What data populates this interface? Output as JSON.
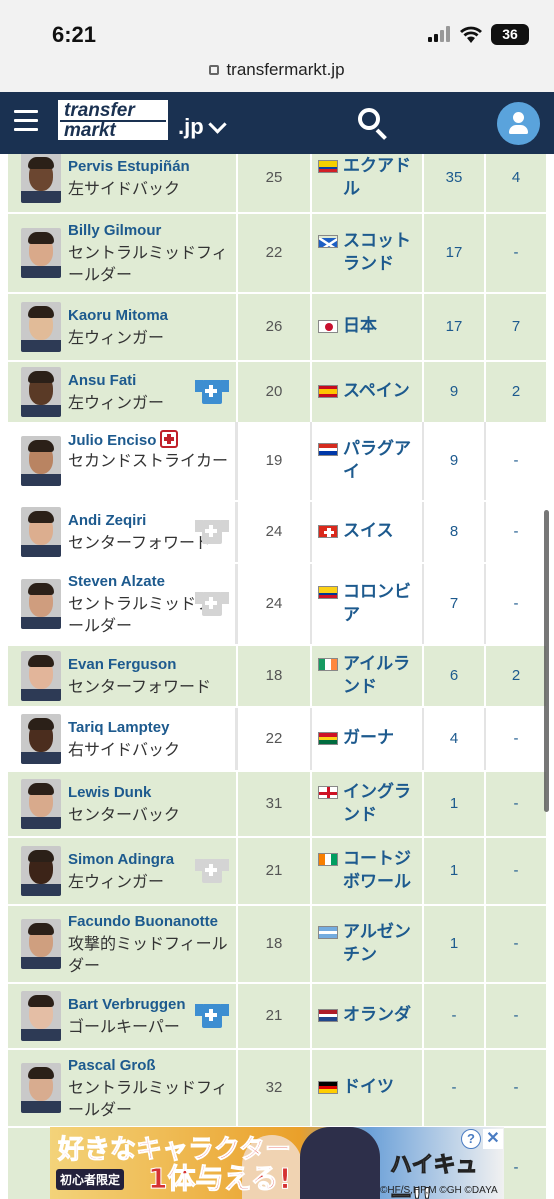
{
  "status": {
    "time": "6:21",
    "battery": "36"
  },
  "browser": {
    "url": "transfermarkt.jp"
  },
  "header": {
    "logo_line1": "transfer",
    "logo_line2": "markt",
    "domain": ".jp"
  },
  "players": [
    {
      "name": "Pervis Estupiñán",
      "position": "左サイドバック",
      "age": "25",
      "nationality": "エクアドル",
      "apps": "35",
      "goals": "4",
      "bg": "green",
      "flag": "ecuador",
      "shirt": "none",
      "injury": false,
      "skin": "#6b4630"
    },
    {
      "name": "Billy Gilmour",
      "position": "セントラルミッドフィールダー",
      "age": "22",
      "nationality": "スコットランド",
      "apps": "17",
      "goals": "-",
      "bg": "green",
      "flag": "scotland",
      "shirt": "none",
      "injury": false,
      "skin": "#d9a98a"
    },
    {
      "name": "Kaoru Mitoma",
      "position": "左ウィンガー",
      "age": "26",
      "nationality": "日本",
      "apps": "17",
      "goals": "7",
      "bg": "green",
      "flag": "japan",
      "shirt": "none",
      "injury": false,
      "skin": "#e1bb98"
    },
    {
      "name": "Ansu Fati",
      "position": "左ウィンガー",
      "age": "20",
      "nationality": "スペイン",
      "apps": "9",
      "goals": "2",
      "bg": "green",
      "flag": "spain",
      "shirt": "blue",
      "injury": false,
      "skin": "#5a3a26"
    },
    {
      "name": "Julio Enciso",
      "position": "セカンドストライカー",
      "age": "19",
      "nationality": "パラグアイ",
      "apps": "9",
      "goals": "-",
      "bg": "white",
      "flag": "paraguay",
      "shirt": "none",
      "injury": true,
      "skin": "#b98462"
    },
    {
      "name": "Andi Zeqiri",
      "position": "センターフォワード",
      "age": "24",
      "nationality": "スイス",
      "apps": "8",
      "goals": "-",
      "bg": "white",
      "flag": "switzerland",
      "shirt": "grey",
      "injury": false,
      "skin": "#dcae8f"
    },
    {
      "name": "Steven Alzate",
      "position": "セントラルミッドフィールダー",
      "age": "24",
      "nationality": "コロンビア",
      "apps": "7",
      "goals": "-",
      "bg": "white",
      "flag": "colombia",
      "shirt": "grey",
      "injury": false,
      "skin": "#cf9d7e"
    },
    {
      "name": "Evan Ferguson",
      "position": "センターフォワード",
      "age": "18",
      "nationality": "アイルランド",
      "apps": "6",
      "goals": "2",
      "bg": "green",
      "flag": "ireland",
      "shirt": "none",
      "injury": false,
      "skin": "#e2b59a"
    },
    {
      "name": "Tariq Lamptey",
      "position": "右サイドバック",
      "age": "22",
      "nationality": "ガーナ",
      "apps": "4",
      "goals": "-",
      "bg": "white",
      "flag": "ghana",
      "shirt": "none",
      "injury": false,
      "skin": "#4b2d1e"
    },
    {
      "name": "Lewis Dunk",
      "position": "センターバック",
      "age": "31",
      "nationality": "イングランド",
      "apps": "1",
      "goals": "-",
      "bg": "green",
      "flag": "england",
      "shirt": "none",
      "injury": false,
      "skin": "#d8aa8c"
    },
    {
      "name": "Simon Adingra",
      "position": "左ウィンガー",
      "age": "21",
      "nationality": "コートジボワール",
      "apps": "1",
      "goals": "-",
      "bg": "green",
      "flag": "ivorycoast",
      "shirt": "grey",
      "injury": false,
      "skin": "#3c2418"
    },
    {
      "name": "Facundo Buonanotte",
      "position": "攻撃的ミッドフィールダー",
      "age": "18",
      "nationality": "アルゼンチン",
      "apps": "1",
      "goals": "-",
      "bg": "green",
      "flag": "argentina",
      "shirt": "none",
      "injury": false,
      "skin": "#cf9f7f"
    },
    {
      "name": "Bart Verbruggen",
      "position": "ゴールキーパー",
      "age": "21",
      "nationality": "オランダ",
      "apps": "-",
      "goals": "-",
      "bg": "green",
      "flag": "netherlands",
      "shirt": "blue",
      "injury": false,
      "skin": "#e4bea5"
    },
    {
      "name": "Pascal Groß",
      "position": "セントラルミッドフィールダー",
      "age": "32",
      "nationality": "ドイツ",
      "apps": "-",
      "goals": "-",
      "bg": "green",
      "flag": "germany",
      "shirt": "none",
      "injury": false,
      "skin": "#d8ac8f"
    },
    {
      "name": "",
      "position": "",
      "age": "",
      "nationality": "",
      "apps": "",
      "goals": "-",
      "bg": "green",
      "flag": "none",
      "shirt": "none",
      "injury": false,
      "skin": "#d8ac8f"
    }
  ],
  "ad": {
    "headline": "好きなキャラクター",
    "badge": "初心者限定",
    "offer": "1体与える!",
    "title": "ハイキュー!!",
    "copyright": "©HF/S,HP,M ©GH ©DAYA",
    "info": "?",
    "close": "✕"
  },
  "colors": {
    "header_bg": "#1a3151",
    "link": "#1d5a8e",
    "row_green": "#e0ebd4",
    "shirt_blue": "#3d8ed1",
    "shirt_grey": "#d4d4d4"
  }
}
